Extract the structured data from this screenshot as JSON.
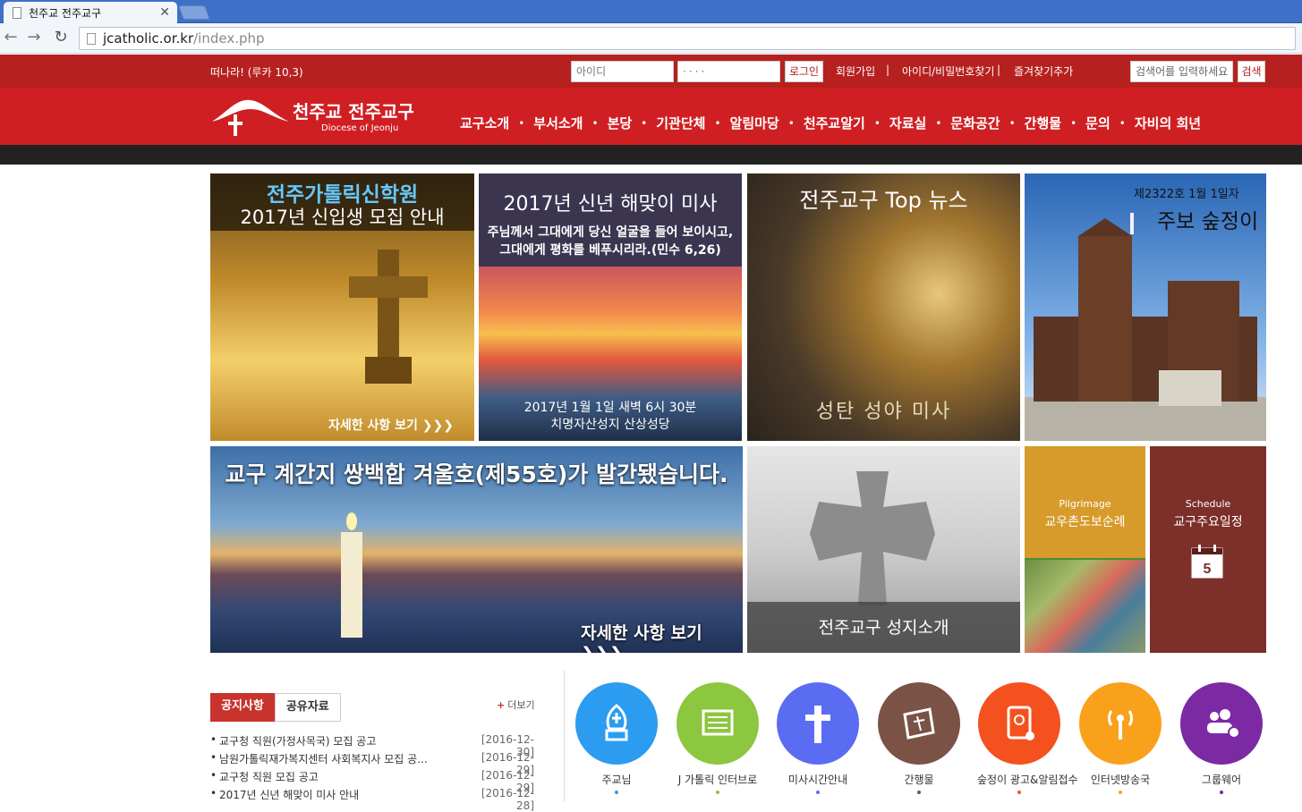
{
  "browser": {
    "tab_title": "천주교 전주교구",
    "url_host": "jcatholic.or.kr",
    "url_path": "/index.php"
  },
  "topbar": {
    "verse": "떠나라! (루카 10,3)",
    "id_placeholder": "아이디",
    "pw_value": "····",
    "login_label": "로그인",
    "links": [
      "회원가입",
      "아이디/비밀번호찾기",
      "즐겨찾기추가"
    ],
    "search_placeholder": "검색어를 입력하세요",
    "search_label": "검색"
  },
  "header": {
    "logo_name": "천주교 전주교구",
    "logo_sub": "Diocese of Jeonju",
    "nav": [
      "교구소개",
      "부서소개",
      "본당",
      "기관단체",
      "알림마당",
      "천주교알기",
      "자료실",
      "문화공간",
      "간행물",
      "문의",
      "자비의 희년"
    ]
  },
  "tiles": {
    "seminary": {
      "line1": "전주가톨릭신학원",
      "line2": "2017년 신입생 모집 안내",
      "more": "자세한 사항 보기 ❯❯❯"
    },
    "sunrise": {
      "title": "2017년 신년 해맞이 미사",
      "quote1": "주님께서 그대에게 당신 얼굴을 들어 보이시고,",
      "quote2": "그대에게 평화를 베푸시리라.(민수 6,26)",
      "when": "2017년 1월 1일 새벽 6시 30분",
      "where": "치명자산성지 산상성당"
    },
    "news": {
      "title": "전주교구 Top 뉴스",
      "caption": "성탄 성야 미사"
    },
    "bulletin": {
      "issue": "제2322호 1월 1일자",
      "title": "주보 숲정이"
    },
    "magazine": {
      "title": "교구 계간지 쌍백합 겨울호(제55호)가 발간됐습니다.",
      "more": "자세한 사항 보기 ❯❯❯"
    },
    "pilgrim_site": {
      "caption": "전주교구 성지소개"
    },
    "pilgrimage": {
      "en": "Pilgrimage",
      "ko": "교우촌도보순례"
    },
    "schedule": {
      "en": "Schedule",
      "ko": "교구주요일정",
      "day": "5"
    }
  },
  "notices": {
    "tabs": [
      "공지사항",
      "공유자료"
    ],
    "more": "더보기",
    "items": [
      {
        "title": "교구청 직원(가정사목국) 모집 공고",
        "date": "[2016-12-30]"
      },
      {
        "title": "남원가톨릭재가복지센터 사회복지사 모집 공...",
        "date": "[2016-12-29]"
      },
      {
        "title": "교구청 직원 모집 공고",
        "date": "[2016-12-29]"
      },
      {
        "title": "2017년 신년 해맞이 미사 안내",
        "date": "[2016-12-28]"
      }
    ]
  },
  "quick_links": [
    {
      "label": "주교님",
      "color": "#2b9cf0",
      "icon": "bishop-mitre-icon"
    },
    {
      "label": "J 가톨릭 인터브로",
      "color": "#8dc63f",
      "icon": "newspaper-icon"
    },
    {
      "label": "미사시간안내",
      "color": "#5a6cf2",
      "icon": "cross-icon"
    },
    {
      "label": "간행물",
      "color": "#7a5246",
      "icon": "book-icon"
    },
    {
      "label": "숲정이 광고&알림접수",
      "color": "#f4511e",
      "icon": "ad-edit-icon"
    },
    {
      "label": "인터넷방송국",
      "color": "#f9a11b",
      "icon": "broadcast-icon"
    },
    {
      "label": "그룹웨어",
      "color": "#7b2aa4",
      "icon": "group-icon"
    }
  ]
}
